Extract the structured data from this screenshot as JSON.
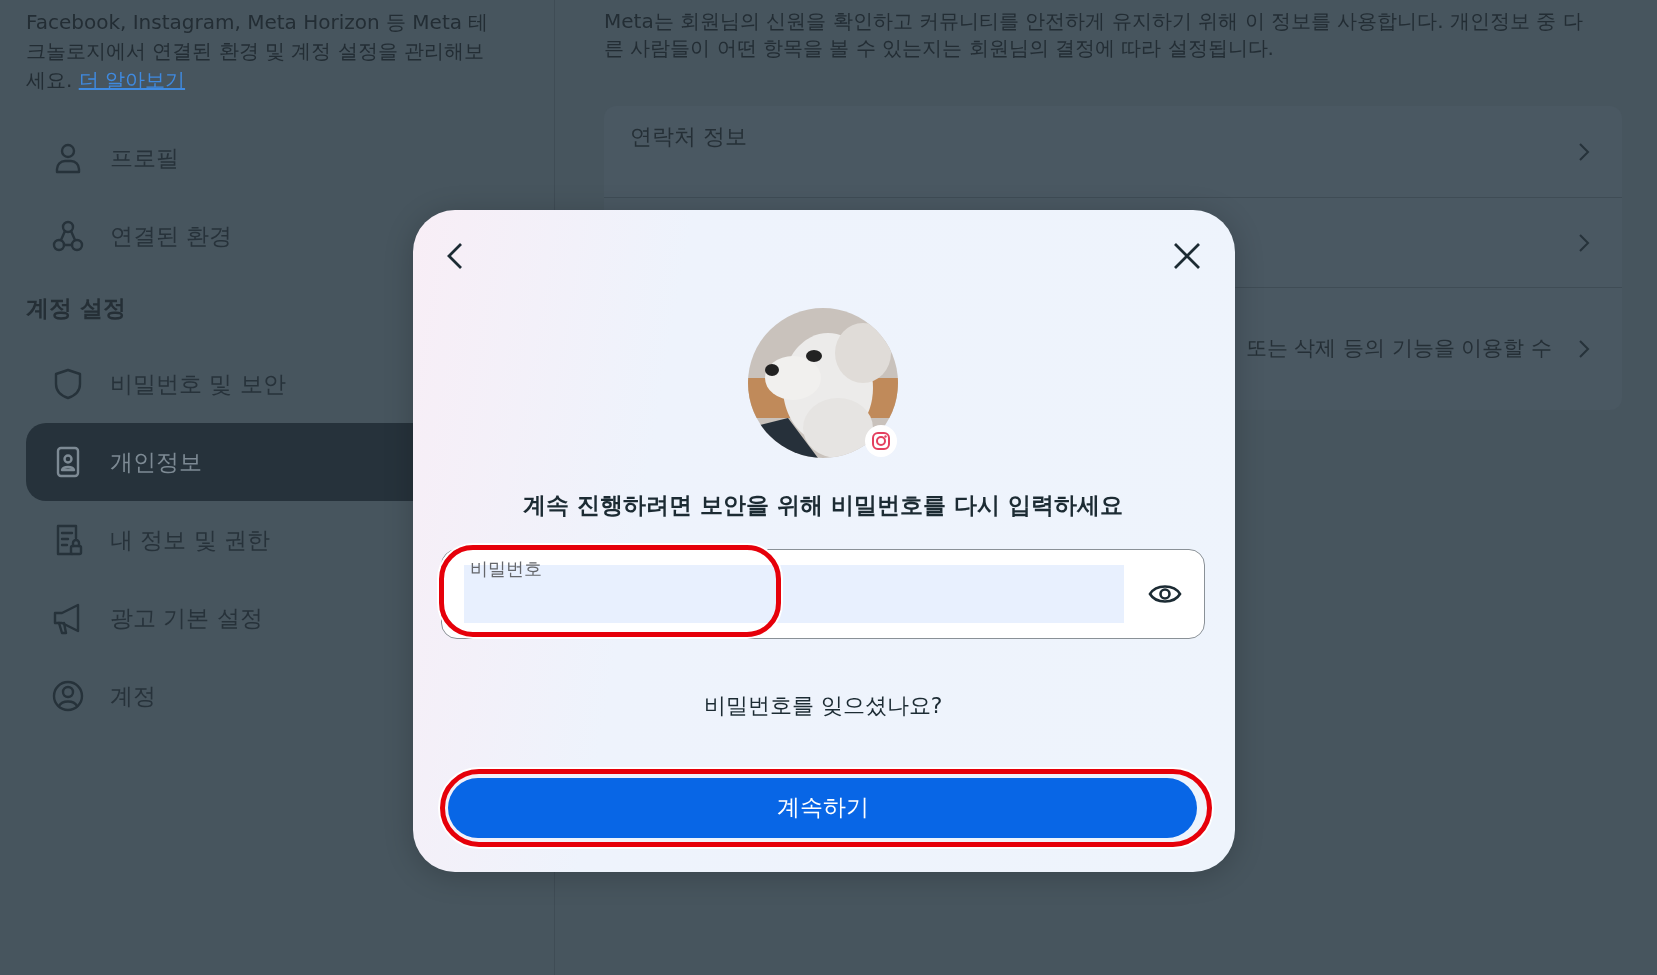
{
  "sidebar": {
    "description": "Facebook, Instagram, Meta Horizon 등 Meta 테크놀로지에서 연결된 환경 및 계정 설정을 관리해보세요.",
    "learn_more_link": "더 알아보기",
    "items": [
      {
        "label": "프로필",
        "selected": false
      },
      {
        "label": "연결된 환경",
        "selected": false
      }
    ],
    "section_heading": "계정 설정",
    "section_items": [
      {
        "label": "비밀번호 및 보안",
        "selected": false
      },
      {
        "label": "개인정보",
        "selected": true
      },
      {
        "label": "내 정보 및 권한",
        "selected": false
      },
      {
        "label": "광고 기본 설정",
        "selected": false
      },
      {
        "label": "계정",
        "selected": false
      }
    ]
  },
  "main": {
    "description": "Meta는 회원님의 신원을 확인하고 커뮤니티를 안전하게 유지하기 위해 이 정보를 사용합니다. 개인정보 중 다른 사람들이 어떤 항목을 볼 수 있는지는 회원님의 결정에 따라 설정됩니다.",
    "rows": [
      {
        "title": "연락처 정보"
      },
      {},
      {
        "text": "또는 삭제 등의 기능을 이용할 수"
      }
    ]
  },
  "dialog": {
    "prompt": "계속 진행하려면 보안을 위해 비밀번호를 다시 입력하세요",
    "password_field": {
      "label": "비밀번호",
      "highlighted": true
    },
    "forgot_link": "비밀번호를 잊으셨나요?",
    "continue_button": {
      "label": "계속하기",
      "highlighted": true
    }
  }
}
